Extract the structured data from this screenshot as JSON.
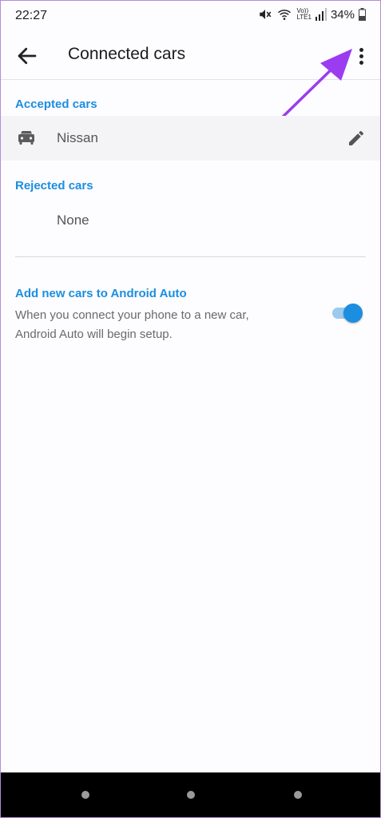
{
  "status_bar": {
    "time": "22:27",
    "volte_label": "Vo))\nLTE1",
    "battery": "34%"
  },
  "header": {
    "title": "Connected cars",
    "back_icon": "arrow-back-icon",
    "more_icon": "more-vert-icon"
  },
  "accepted": {
    "heading": "Accepted cars",
    "car_name": "Nissan",
    "car_icon": "car-icon",
    "edit_icon": "pencil-icon"
  },
  "rejected": {
    "heading": "Rejected cars",
    "empty_text": "None"
  },
  "new_cars": {
    "heading": "Add new cars to Android Auto",
    "description": "When you connect your phone to a new car, Android Auto will begin setup.",
    "toggle_on": true
  },
  "colors": {
    "accent": "#1b8ee0",
    "annotation_arrow": "#9b3cf0"
  }
}
